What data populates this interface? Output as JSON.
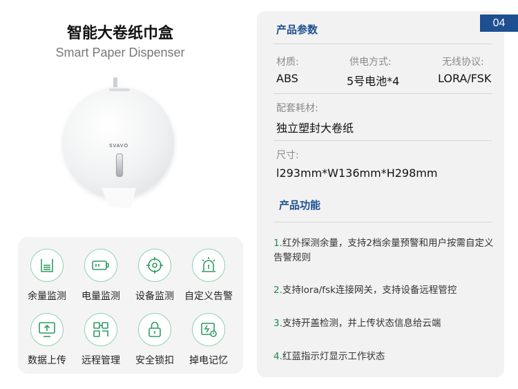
{
  "header": {
    "title_cn": "智能大卷纸巾盒",
    "title_en": "Smart Paper Dispenser",
    "page_number": "04"
  },
  "product": {
    "brand": "SVAVO"
  },
  "features": [
    {
      "label": "余量监测",
      "icon": "remaining-level-icon"
    },
    {
      "label": "电量监测",
      "icon": "battery-icon"
    },
    {
      "label": "设备监测",
      "icon": "target-icon"
    },
    {
      "label": "自定义告警",
      "icon": "alarm-light-icon"
    },
    {
      "label": "数据上传",
      "icon": "upload-monitor-icon"
    },
    {
      "label": "远程管理",
      "icon": "remote-grid-icon"
    },
    {
      "label": "安全锁扣",
      "icon": "lock-icon"
    },
    {
      "label": "掉电记忆",
      "icon": "power-memory-icon"
    }
  ],
  "params": {
    "title": "产品参数",
    "material_label": "材质:",
    "material_value": "ABS",
    "power_label": "供电方式:",
    "power_value": "5号电池*4",
    "wireless_label": "无线协议:",
    "wireless_value": "LORA/FSK",
    "consumable_label": "配套耗材:",
    "consumable_value": "独立塑封大卷纸",
    "size_label": "尺寸:",
    "size_value": "l293mm*W136mm*H298mm"
  },
  "functions": {
    "title": "产品功能",
    "items": [
      {
        "num": "1.",
        "text": "红外探测余量，支持2档余量预警和用户按需自定义告警规则"
      },
      {
        "num": "2.",
        "text": "支持lora/fsk连接网关，支持设备远程管控"
      },
      {
        "num": "3.",
        "text": "支持开盖检测，并上传状态信息给云端"
      },
      {
        "num": "4.",
        "text": "红蓝指示灯显示工作状态"
      }
    ]
  },
  "colors": {
    "accent": "#1d4f91",
    "icon_green": "#2e9a63",
    "number_green": "#1a8a4a"
  }
}
